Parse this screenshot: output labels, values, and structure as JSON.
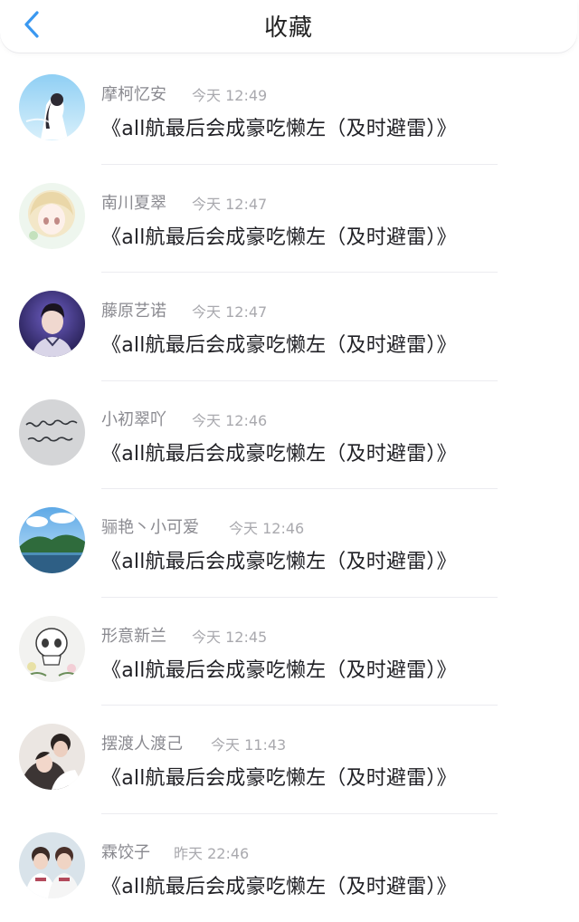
{
  "header": {
    "title": "收藏",
    "back_icon": "chevron-left-icon",
    "accent_color": "#3a98f0"
  },
  "items": [
    {
      "user": "摩柯忆安",
      "time": "今天 12:49",
      "title": "《all航最后会成豪吃懒左（及时避雷）》",
      "avatar_icon": "avatar-girl-sky"
    },
    {
      "user": "南川夏翠",
      "time": "今天 12:47",
      "title": "《all航最后会成豪吃懒左（及时避雷）》",
      "avatar_icon": "avatar-anime-girl"
    },
    {
      "user": "藤原艺诺",
      "time": "今天 12:47",
      "title": "《all航最后会成豪吃懒左（及时避雷）》",
      "avatar_icon": "avatar-boy-purple"
    },
    {
      "user": "小初翠吖",
      "time": "今天 12:46",
      "title": "《all航最后会成豪吃懒左（及时避雷）》",
      "avatar_icon": "avatar-handwriting"
    },
    {
      "user": "骊艳丶小可爱",
      "time": "今天 12:46",
      "title": "《all航最后会成豪吃懒左（及时避雷）》",
      "avatar_icon": "avatar-landscape"
    },
    {
      "user": "形意新兰",
      "time": "今天 12:45",
      "title": "《all航最后会成豪吃懒左（及时避雷）》",
      "avatar_icon": "avatar-skull-flowers"
    },
    {
      "user": "摆渡人渡己",
      "time": "今天 11:43",
      "title": "《all航最后会成豪吃懒左（及时避雷）》",
      "avatar_icon": "avatar-couple"
    },
    {
      "user": "霖饺子",
      "time": "昨天 22:46",
      "title": "《all航最后会成豪吃懒左（及时避雷）》",
      "avatar_icon": "avatar-two-boys"
    }
  ]
}
